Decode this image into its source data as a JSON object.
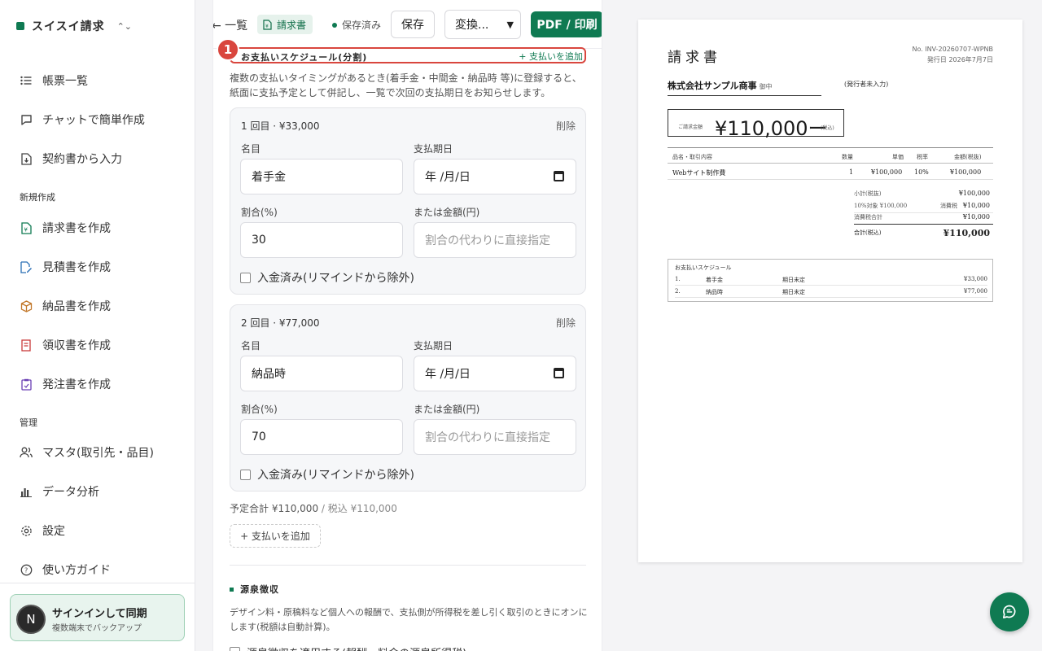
{
  "brand": {
    "name": "スイスイ請求",
    "chevron": "⌃⌄"
  },
  "sidebar": {
    "items": [
      {
        "label": "帳票一覧"
      },
      {
        "label": "チャットで簡単作成"
      },
      {
        "label": "契約書から入力"
      }
    ],
    "section_new": "新規作成",
    "new_items": [
      {
        "label": "請求書を作成"
      },
      {
        "label": "見積書を作成"
      },
      {
        "label": "納品書を作成"
      },
      {
        "label": "領収書を作成"
      },
      {
        "label": "発注書を作成"
      }
    ],
    "section_manage": "管理",
    "manage_items": [
      {
        "label": "マスタ(取引先・品目)"
      },
      {
        "label": "データ分析"
      },
      {
        "label": "設定"
      },
      {
        "label": "使い方ガイド"
      }
    ],
    "signin": {
      "avatar": "N",
      "title": "サインインして同期",
      "subtitle": "複数端末でバックアップ"
    }
  },
  "toolbar": {
    "back": "← 一覧",
    "doc_type": "請求書",
    "saved": "保存済み",
    "save": "保存",
    "convert": "変換...",
    "pdf": "PDF / 印刷"
  },
  "schedule": {
    "step": "1",
    "title": "お支払いスケジュール(分割)",
    "add_link": "+ 支払いを追加",
    "description": "複数の支払いタイミングがあるとき(着手金・中間金・納品時 等)に登録すると、紙面に支払予定として併記し、一覧で次回の支払期日をお知らせします。",
    "labels": {
      "name": "名目",
      "due": "支払期日",
      "ratio": "割合(%)",
      "amount": "または金額(円)",
      "paid": "入金済み(リマインドから除外)",
      "delete": "削除"
    },
    "date_placeholder": "年 /月/日",
    "amount_placeholder": "割合の代わりに直接指定",
    "payments": [
      {
        "title": "1 回目 · ¥33,000",
        "name": "着手金",
        "ratio": "30"
      },
      {
        "title": "2 回目 · ¥77,000",
        "name": "納品時",
        "ratio": "70"
      }
    ],
    "planned_total": "予定合計 ¥110,000",
    "planned_tax": " / 税込 ¥110,000",
    "add_button": "+ 支払いを追加"
  },
  "withholding": {
    "title": "源泉徴収",
    "description": "デザイン料・原稿料など個人への報酬で、支払側が所得税を差し引く取引のときにオンにします(税額は自動計算)。",
    "checkbox": "源泉徴収を適用する(報酬・料金の源泉所得税)"
  },
  "preview": {
    "title": "請求書",
    "number": "No. INV-20260707-WPNB",
    "issue_date": "発行日 2026年7月7日",
    "client": "株式会社サンプル商事",
    "honorific": "御中",
    "issuer": "(発行者未入力)",
    "total_label": "ご請求金額",
    "total": "¥110,000ー",
    "total_tax": "(税込)",
    "headers": {
      "item": "品名・取引内容",
      "qty": "数量",
      "unit": "単価",
      "rate": "税率",
      "amount": "金額(税抜)"
    },
    "rows": [
      {
        "item": "Webサイト制作費",
        "qty": "1",
        "unit": "¥100,000",
        "rate": "10%",
        "amount": "¥100,000"
      }
    ],
    "summary": {
      "subtotal_label": "小計(税抜)",
      "subtotal": "¥100,000",
      "target_label": "10%対象 ¥100,000",
      "tax_label": "消費税",
      "tax": "¥10,000",
      "tax_total_label": "消費税合計",
      "tax_total": "¥10,000",
      "total_label": "合計(税込)",
      "total": "¥110,000"
    },
    "schedule_title": "お支払いスケジュール",
    "schedule_rows": [
      {
        "no": "1.",
        "name": "着手金",
        "due": "期日未定",
        "amount": "¥33,000"
      },
      {
        "no": "2.",
        "name": "納品時",
        "due": "期日未定",
        "amount": "¥77,000"
      }
    ]
  }
}
